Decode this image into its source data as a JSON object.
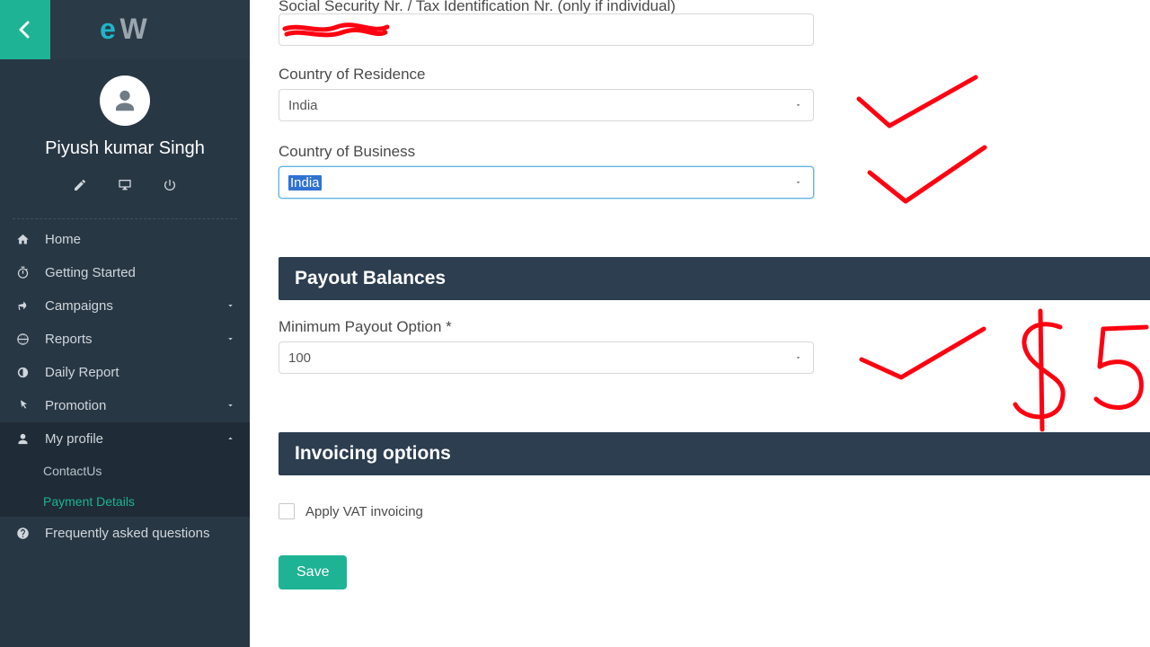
{
  "user": {
    "name": "Piyush kumar Singh"
  },
  "sidebar": {
    "items": [
      {
        "key": "home",
        "label": "Home"
      },
      {
        "key": "started",
        "label": "Getting Started"
      },
      {
        "key": "camp",
        "label": "Campaigns"
      },
      {
        "key": "reports",
        "label": "Reports"
      },
      {
        "key": "daily",
        "label": "Daily Report"
      },
      {
        "key": "promo",
        "label": "Promotion"
      },
      {
        "key": "profile",
        "label": "My profile"
      },
      {
        "key": "faq",
        "label": "Frequently asked questions"
      }
    ],
    "profile_sub": [
      {
        "key": "contact",
        "label": "ContactUs"
      },
      {
        "key": "payment",
        "label": "Payment Details"
      }
    ]
  },
  "form": {
    "ssn_label": "Social Security Nr. / Tax Identification Nr. (only if individual)",
    "ssn_value": "",
    "cor_label": "Country of Residence",
    "cor_value": "India",
    "cob_label": "Country of Business",
    "cob_value": "India",
    "section_payout": "Payout Balances",
    "mpo_label": "Minimum Payout Option *",
    "mpo_value": "100",
    "section_invoice": "Invoicing options",
    "vat_label": "Apply VAT invoicing",
    "save_label": "Save"
  }
}
